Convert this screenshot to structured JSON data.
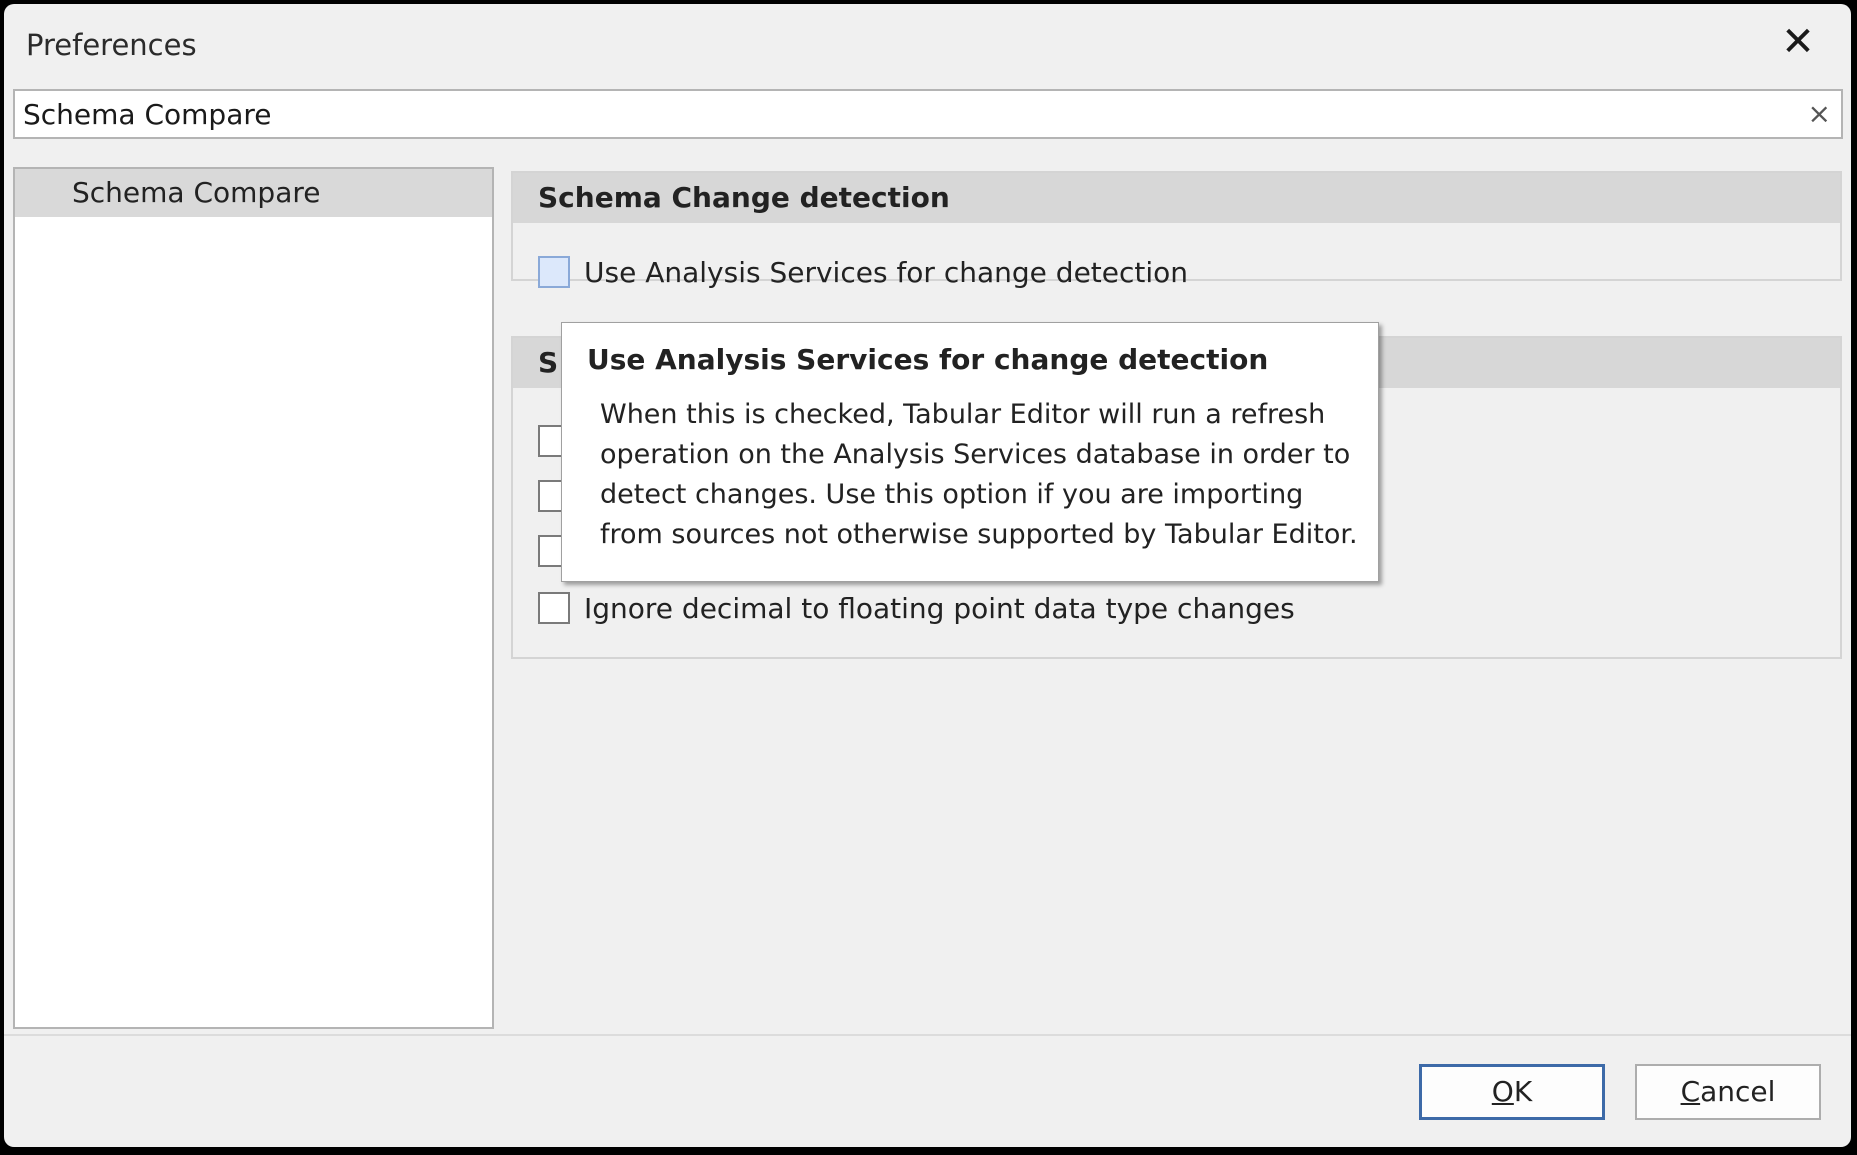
{
  "window": {
    "title": "Preferences"
  },
  "search": {
    "value": "Schema Compare",
    "clear_glyph": "×"
  },
  "tree": {
    "items": [
      {
        "label": "Schema Compare"
      }
    ]
  },
  "groups": [
    {
      "header": "Schema Change detection",
      "options": [
        {
          "label": "Use Analysis Services for change detection",
          "checked": false
        }
      ]
    },
    {
      "header": "S",
      "options": [
        {
          "label": "",
          "checked": false
        },
        {
          "label": "",
          "checked": false
        },
        {
          "label": "",
          "checked": false
        },
        {
          "label": "Ignore decimal to floating point data type changes",
          "checked": false
        }
      ]
    }
  ],
  "tooltip": {
    "title": "Use Analysis Services for change detection",
    "body": "When this is checked, Tabular Editor will run a refresh operation on the Analysis Services database in order to detect changes. Use this option if you are importing from sources not otherwise supported by Tabular Editor."
  },
  "buttons": {
    "ok_accel": "O",
    "ok_rest": "K",
    "cancel_accel": "C",
    "cancel_rest": "ancel"
  },
  "icons": {
    "close": "close-icon",
    "clear": "clear-icon"
  }
}
